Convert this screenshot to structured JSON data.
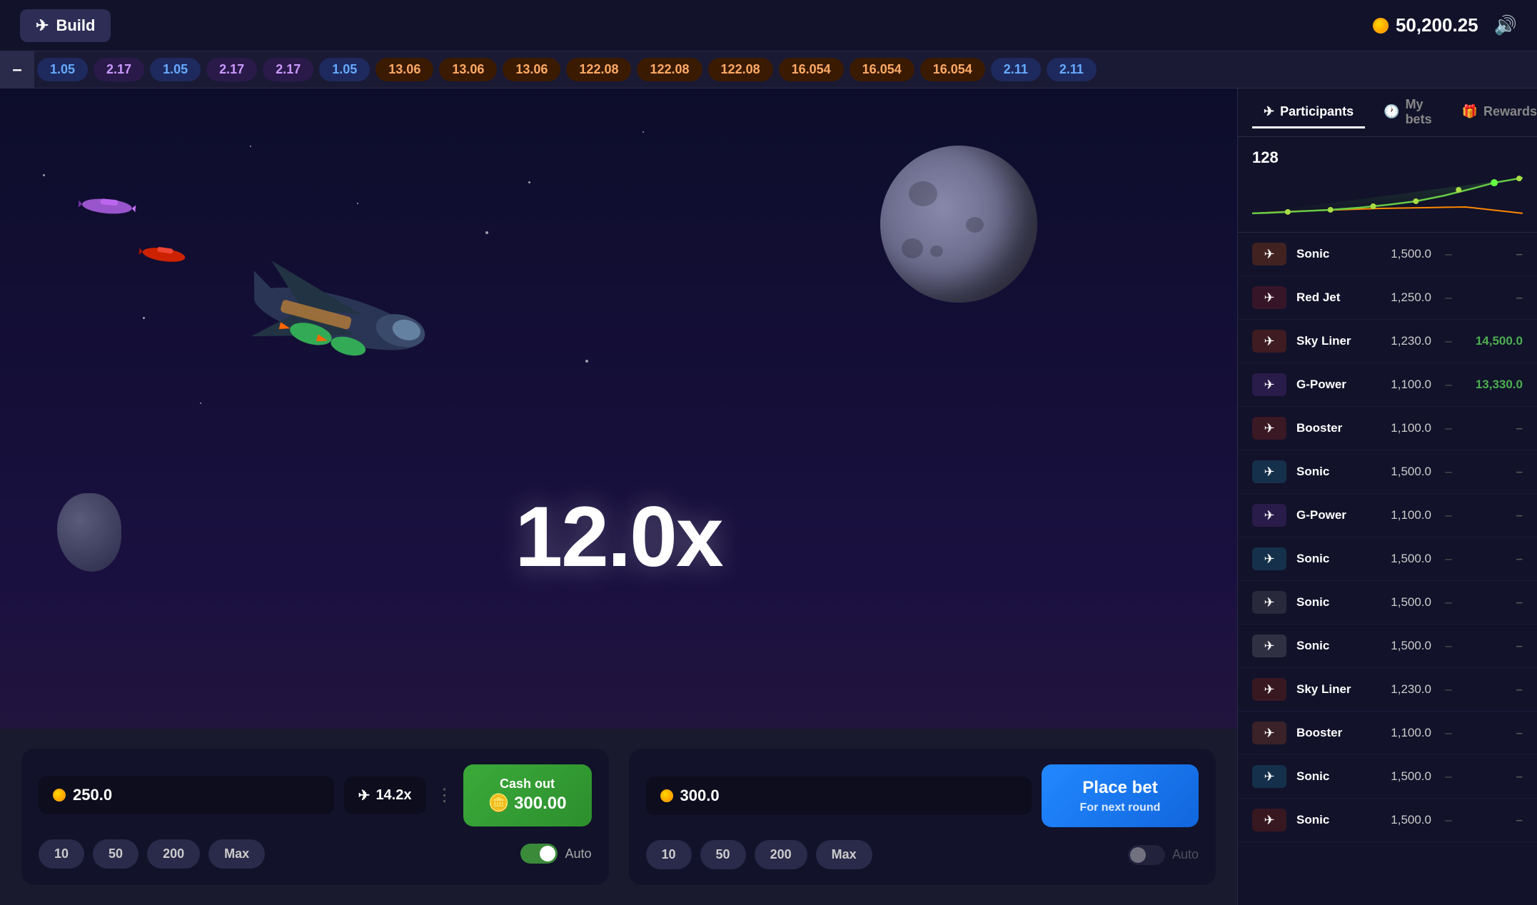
{
  "header": {
    "build_label": "Build",
    "balance": "50,200.25",
    "sound_icon": "🔊"
  },
  "ticker": {
    "minus": "–",
    "items": [
      {
        "value": "1.05",
        "type": "blue"
      },
      {
        "value": "2.17",
        "type": "purple"
      },
      {
        "value": "1.05",
        "type": "blue"
      },
      {
        "value": "2.17",
        "type": "purple"
      },
      {
        "value": "2.17",
        "type": "purple"
      },
      {
        "value": "1.05",
        "type": "blue"
      },
      {
        "value": "13.06",
        "type": "orange"
      },
      {
        "value": "13.06",
        "type": "orange"
      },
      {
        "value": "13.06",
        "type": "orange"
      },
      {
        "value": "122.08",
        "type": "orange"
      },
      {
        "value": "122.08",
        "type": "orange"
      },
      {
        "value": "122.08",
        "type": "orange"
      },
      {
        "value": "16.054",
        "type": "orange"
      },
      {
        "value": "16.054",
        "type": "orange"
      },
      {
        "value": "16.054",
        "type": "orange"
      },
      {
        "value": "2.11",
        "type": "blue"
      },
      {
        "value": "2.11",
        "type": "blue"
      }
    ]
  },
  "game": {
    "multiplier": "12.0x"
  },
  "bet_panel_1": {
    "amount": "250.0",
    "multiplier": "14.2x",
    "cashout_label": "Cash out",
    "cashout_amount": "300.00",
    "chips": [
      "10",
      "50",
      "200",
      "Max"
    ],
    "auto_label": "Auto",
    "auto_active": true
  },
  "bet_panel_2": {
    "amount": "300.0",
    "place_bet_line1": "Place bet",
    "place_bet_line2": "For next round",
    "chips": [
      "10",
      "50",
      "200",
      "Max"
    ],
    "auto_label": "Auto",
    "auto_active": false
  },
  "right_panel": {
    "tabs": [
      {
        "id": "participants",
        "label": "Participants",
        "active": true
      },
      {
        "id": "my-bets",
        "label": "My bets",
        "active": false
      },
      {
        "id": "rewards",
        "label": "Rewards",
        "active": false
      }
    ],
    "participant_count": "128",
    "participants": [
      {
        "name": "Sonic",
        "bet": "1,500.0",
        "win": "–",
        "win2": "–",
        "color": "#ff6600"
      },
      {
        "name": "Red Jet",
        "bet": "1,250.0",
        "win": "–",
        "win2": "–",
        "color": "#cc2222"
      },
      {
        "name": "Sky Liner",
        "bet": "1,230.0",
        "win": "–",
        "win2": "14,500.0",
        "color": "#ee4400"
      },
      {
        "name": "G-Power",
        "bet": "1,100.0",
        "win": "–",
        "win2": "13,330.0",
        "color": "#8844cc"
      },
      {
        "name": "Booster",
        "bet": "1,100.0",
        "win": "–",
        "win2": "–",
        "color": "#dd3311"
      },
      {
        "name": "Sonic",
        "bet": "1,500.0",
        "win": "–",
        "win2": "–",
        "color": "#22aacc"
      },
      {
        "name": "G-Power",
        "bet": "1,100.0",
        "win": "–",
        "win2": "–",
        "color": "#8844cc"
      },
      {
        "name": "Sonic",
        "bet": "1,500.0",
        "win": "–",
        "win2": "–",
        "color": "#22aacc"
      },
      {
        "name": "Sonic",
        "bet": "1,500.0",
        "win": "–",
        "win2": "–",
        "color": "#888888"
      },
      {
        "name": "Sonic",
        "bet": "1,500.0",
        "win": "–",
        "win2": "–",
        "color": "#aaaaaa"
      },
      {
        "name": "Sky Liner",
        "bet": "1,230.0",
        "win": "–",
        "win2": "–",
        "color": "#cc3300"
      },
      {
        "name": "Booster",
        "bet": "1,100.0",
        "win": "–",
        "win2": "–",
        "color": "#dd6622"
      },
      {
        "name": "Sonic",
        "bet": "1,500.0",
        "win": "–",
        "win2": "–",
        "color": "#22aacc"
      },
      {
        "name": "Sonic",
        "bet": "1,500.0",
        "win": "–",
        "win2": "–",
        "color": "#cc3300"
      }
    ]
  }
}
